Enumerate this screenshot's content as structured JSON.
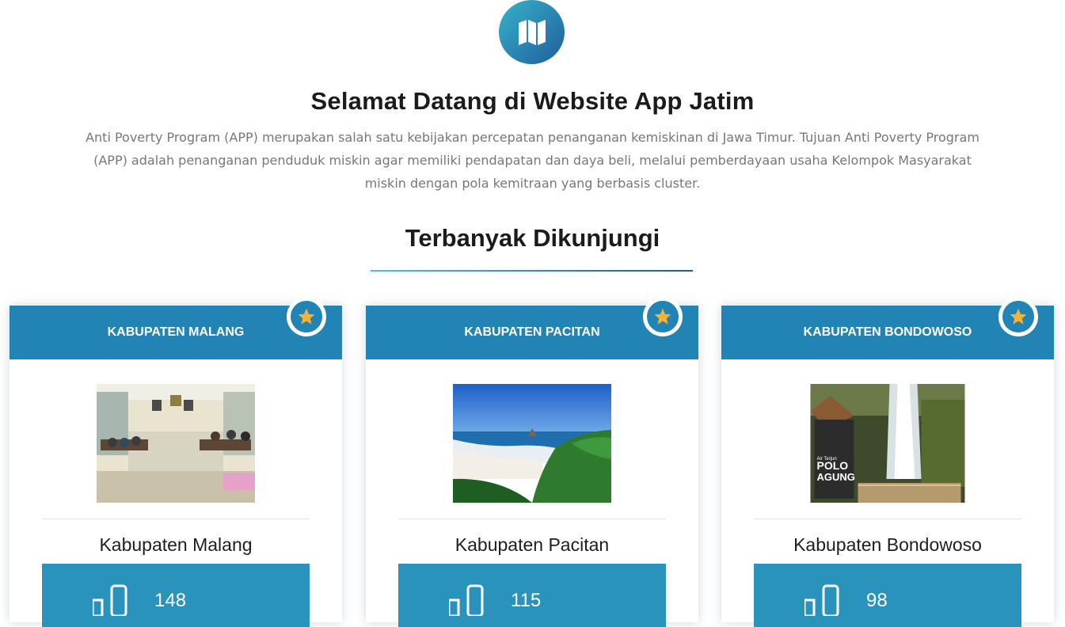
{
  "header": {
    "icon": "map-icon",
    "title": "Selamat Datang di Website App Jatim",
    "description": "Anti Poverty Program (APP) merupakan salah satu kebijakan percepatan penanganan kemiskinan di Jawa Timur. Tujuan Anti Poverty Program (APP) adalah penanganan penduduk miskin agar memiliki pendapatan dan daya beli, melalui pemberdayaan usaha Kelompok Masyarakat miskin dengan pola kemitraan yang berbasis cluster."
  },
  "section": {
    "title": "Terbanyak Dikunjungi"
  },
  "colors": {
    "header_blue": "#2283b5",
    "stat_blue": "#2a93bb",
    "star_yellow": "#f5b335"
  },
  "cards": [
    {
      "header": "KABUPATEN MALANG",
      "name": "Kabupaten Malang",
      "views": "148",
      "badge_icon": "star-icon",
      "stat_icon": "thumbs-up-icon"
    },
    {
      "header": "KABUPATEN PACITAN",
      "name": "Kabupaten Pacitan",
      "views": "115",
      "badge_icon": "star-icon",
      "stat_icon": "thumbs-up-icon"
    },
    {
      "header": "KABUPATEN BONDOWOSO",
      "name": "Kabupaten Bondowoso",
      "views": "98",
      "badge_icon": "star-icon",
      "stat_icon": "thumbs-up-icon",
      "photo_sign": [
        "Air Terjun",
        "POLO",
        "AGUNG"
      ]
    }
  ]
}
